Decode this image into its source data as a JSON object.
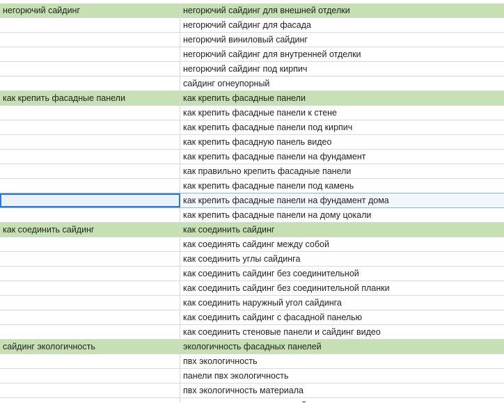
{
  "rows": [
    {
      "a": "негорючий сайдинг",
      "b": "негорючий сайдинг для внешней отделки",
      "group": true
    },
    {
      "a": "",
      "b": "негорючий сайдинг для фасада"
    },
    {
      "a": "",
      "b": "негорючий виниловый сайдинг"
    },
    {
      "a": "",
      "b": "негорючий сайдинг для внутренней отделки"
    },
    {
      "a": "",
      "b": "негорючий сайдинг под кирпич"
    },
    {
      "a": "",
      "b": "сайдинг огнеупорный"
    },
    {
      "a": "как крепить фасадные панели",
      "b": "как крепить фасадные панели",
      "group": true
    },
    {
      "a": "",
      "b": "как крепить фасадные панели к стене"
    },
    {
      "a": "",
      "b": "как крепить фасадные панели под кирпич"
    },
    {
      "a": "",
      "b": "как крепить фасадную панель видео"
    },
    {
      "a": "",
      "b": "как крепить фасадные панели на фундамент"
    },
    {
      "a": "",
      "b": "как правильно крепить фасадные панели"
    },
    {
      "a": "",
      "b": "как крепить фасадные панели под камень"
    },
    {
      "a": "",
      "b": "как крепить фасадные панели на фундамент дома",
      "selected": true
    },
    {
      "a": "",
      "b": "как крепить фасадные панели на дому цокали"
    },
    {
      "a": "как соединить сайдинг",
      "b": "как соединить сайдинг",
      "group": true
    },
    {
      "a": "",
      "b": "как соединять сайдинг между собой"
    },
    {
      "a": "",
      "b": "как соединить углы сайдинга"
    },
    {
      "a": "",
      "b": "как соединить сайдинг без соединительной"
    },
    {
      "a": "",
      "b": "как соединить сайдинг без соединительной планки"
    },
    {
      "a": "",
      "b": "как соединить наружный угол сайдинга"
    },
    {
      "a": "",
      "b": "как соединить сайдинг с фасадной панелью"
    },
    {
      "a": "",
      "b": "как соединить стеновые панели и сайдинг видео"
    },
    {
      "a": "сайдинг экологичность",
      "b": "экологичность фасадных панелей",
      "group": true
    },
    {
      "a": "",
      "b": "пвх экологичность"
    },
    {
      "a": "",
      "b": "панели пвх экологичность"
    },
    {
      "a": "",
      "b": "пвх экологичность материала"
    },
    {
      "a": "",
      "b": "экологичность винилового сайдинга"
    }
  ],
  "colors": {
    "group_fill": "#c6e0b4",
    "grid_line": "#d9d9d9",
    "selection": "#2b79d0"
  }
}
